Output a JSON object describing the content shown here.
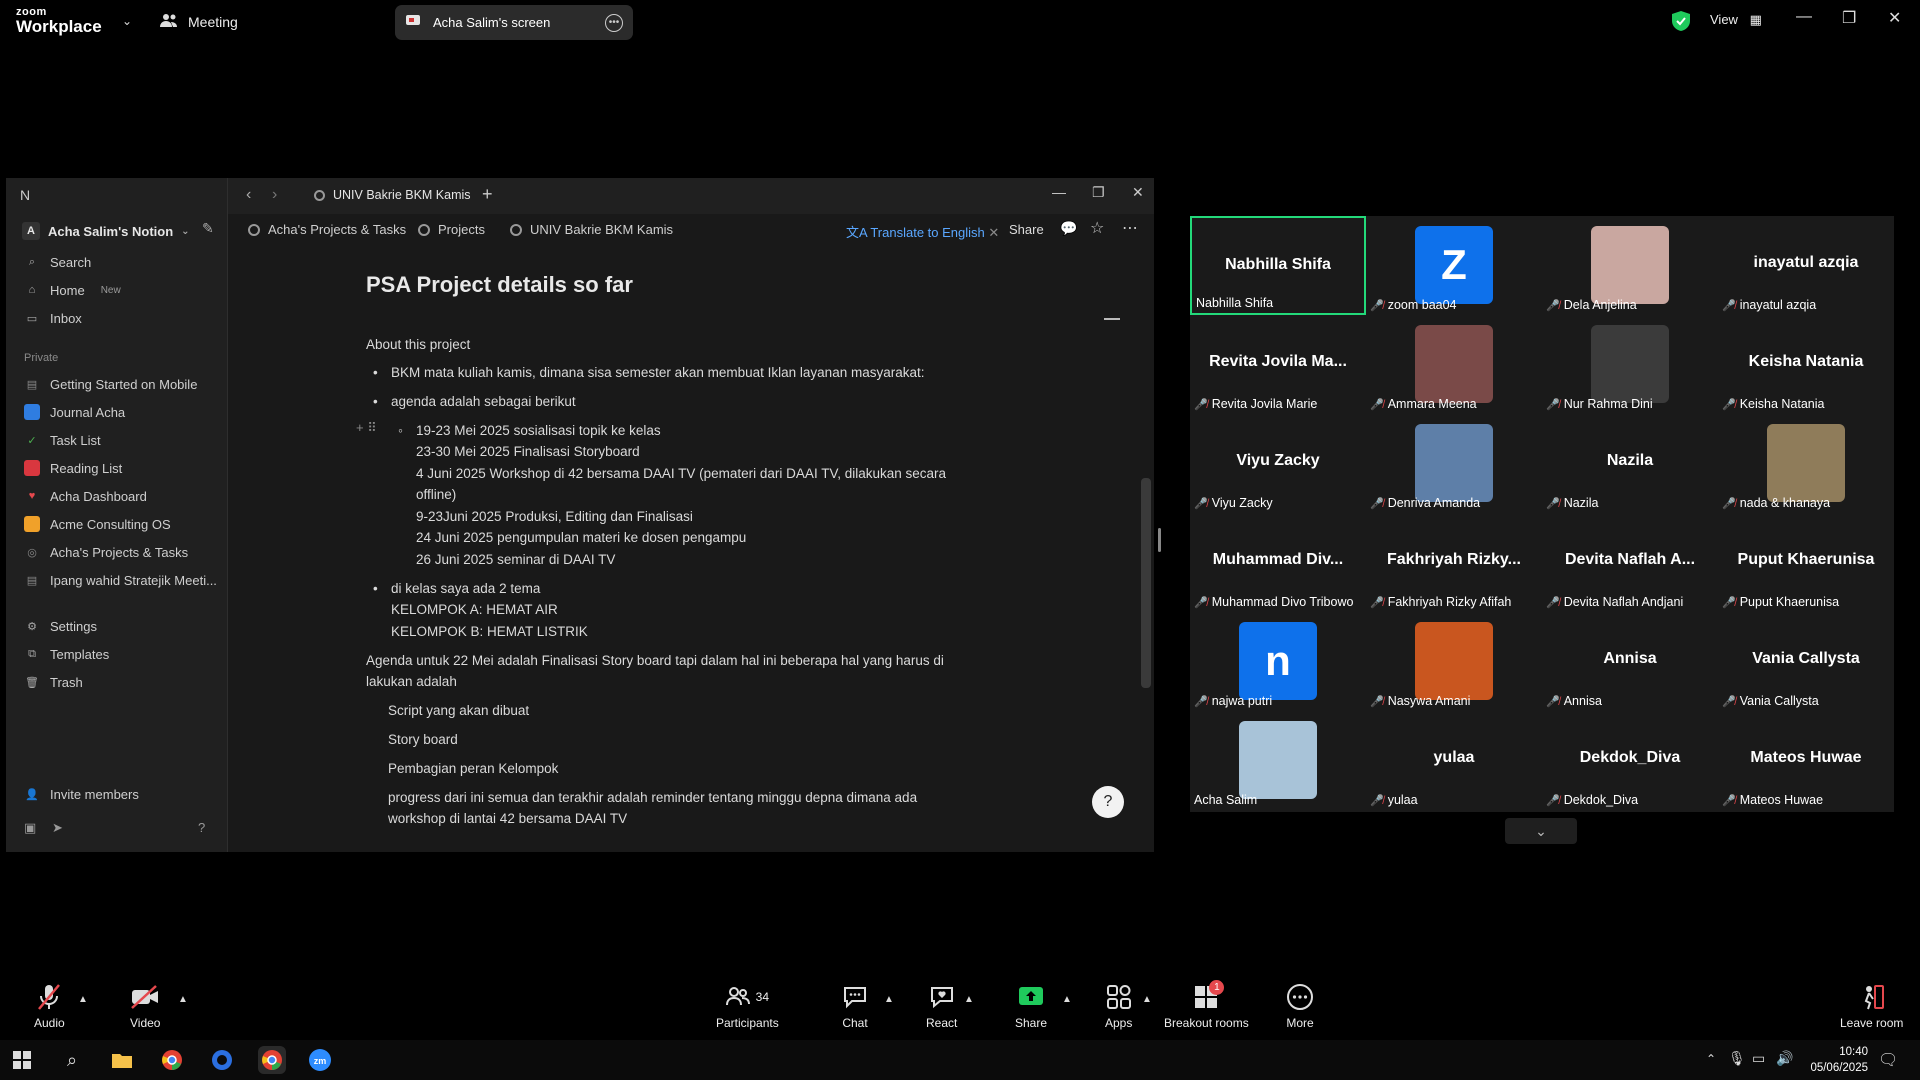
{
  "topbar": {
    "logo_small": "zoom",
    "logo_big": "Workplace",
    "meeting_label": "Meeting",
    "share_pill": "Acha Salim's screen",
    "view_label": "View"
  },
  "notion": {
    "workspace": "Acha Salim's Notion",
    "tab_title": "UNIV Bakrie BKM Kamis",
    "search": "Search",
    "home": "Home",
    "home_badge": "New",
    "inbox": "Inbox",
    "private_label": "Private",
    "pages": [
      "Getting Started on Mobile",
      "Journal Acha",
      "Task List",
      "Reading List",
      "Acha Dashboard",
      "Acme Consulting OS",
      "Acha's Projects & Tasks",
      "Ipang wahid Stratejik Meeti..."
    ],
    "settings": "Settings",
    "templates": "Templates",
    "trash": "Trash",
    "invite": "Invite members",
    "breadcrumbs": [
      "Acha's Projects & Tasks",
      "Projects",
      "UNIV Bakrie BKM Kamis"
    ],
    "translate": "Translate to English",
    "share": "Share",
    "doc": {
      "title": "PSA Project details so far",
      "about": "About this project",
      "b1": "BKM mata kuliah kamis, dimana sisa semester akan membuat Iklan layanan masyarakat:",
      "b2": "agenda adalah sebagai berikut",
      "s1": "19-23 Mei 2025 sosialisasi topik ke kelas",
      "s2": "23-30 Mei 2025 Finalisasi Storyboard",
      "s3": "4 Juni 2025 Workshop di 42 bersama DAAI TV (pemateri dari DAAI TV, dilakukan secara",
      "s3b": "offline)",
      "s4": "9-23Juni 2025 Produksi, Editing dan Finalisasi",
      "s5": "24 Juni 2025 pengumpulan materi ke dosen pengampu",
      "s6": "26 Juni 2025 seminar di DAAI TV",
      "b3": "di kelas saya ada 2 tema",
      "b3a": "KELOMPOK A: HEMAT AIR",
      "b3b": "KELOMPOK B: HEMAT LISTRIK",
      "p1": "Agenda untuk 22 Mei adalah Finalisasi Story board tapi dalam hal ini beberapa hal yang harus di",
      "p1b": "lakukan adalah",
      "t1": "Script yang akan dibuat",
      "t2": "Story board",
      "t3": "Pembagian peran Kelompok",
      "t4": "progress dari ini semua dan terakhir adalah reminder tentang minggu depna dimana ada",
      "t4b": "workshop di lantai 42 bersama DAAI TV"
    }
  },
  "gallery": [
    {
      "big": "Nabhilla Shifa",
      "label": "Nabhilla Shifa",
      "muted": false,
      "active": true
    },
    {
      "letter": "Z",
      "label": "zoom baa04",
      "muted": true
    },
    {
      "photo": "#c9a7a0",
      "label": "Dela Anjelina",
      "muted": true
    },
    {
      "big": "inayatul azqia",
      "label": "inayatul azqia",
      "muted": true
    },
    {
      "big": "Revita Jovila Ma...",
      "label": "Revita Jovila Marie",
      "muted": true
    },
    {
      "photo": "#7a4a48",
      "label": "Ammara Meena",
      "muted": true
    },
    {
      "photo": "#3b3b3b",
      "label": "Nur Rahma Dini",
      "muted": true
    },
    {
      "big": "Keisha Natania",
      "label": "Keisha Natania",
      "muted": true
    },
    {
      "big": "Viyu Zacky",
      "label": "Viyu Zacky",
      "muted": true
    },
    {
      "photo": "#5e7fa8",
      "label": "Denriva Amanda",
      "muted": true
    },
    {
      "big": "Nazila",
      "label": "Nazila",
      "muted": true
    },
    {
      "photo": "#8f7c5a",
      "label": "nada & khanaya",
      "muted": true
    },
    {
      "big": "Muhammad Div...",
      "label": "Muhammad Divo Tribowo",
      "muted": true
    },
    {
      "big": "Fakhriyah Rizky...",
      "label": "Fakhriyah Rizky Afifah",
      "muted": true
    },
    {
      "big": "Devita Naflah A...",
      "label": "Devita Naflah Andjani",
      "muted": true
    },
    {
      "big": "Puput Khaerunisa",
      "label": "Puput Khaerunisa",
      "muted": true
    },
    {
      "letter": "n",
      "label": "najwa putri",
      "muted": true
    },
    {
      "photo": "#c9561f",
      "label": "Nasywa Amani",
      "muted": true
    },
    {
      "big": "Annisa",
      "label": "Annisa",
      "muted": true
    },
    {
      "big": "Vania Callysta",
      "label": "Vania Callysta",
      "muted": true
    },
    {
      "photo": "#a8c3d8",
      "label": "Acha Salim",
      "muted": false
    },
    {
      "big": "yulaa",
      "label": "yulaa",
      "muted": true
    },
    {
      "big": "Dekdok_Diva",
      "label": "Dekdok_Diva",
      "muted": true
    },
    {
      "big": "Mateos Huwae",
      "label": "Mateos Huwae",
      "muted": true
    }
  ],
  "toolbar": {
    "audio": "Audio",
    "video": "Video",
    "participants": "Participants",
    "participants_count": "34",
    "chat": "Chat",
    "react": "React",
    "share": "Share",
    "apps": "Apps",
    "breakout": "Breakout rooms",
    "breakout_badge": "1",
    "more": "More",
    "leave": "Leave room"
  },
  "taskbar": {
    "time": "10:40",
    "date": "05/06/2025"
  },
  "colors": {
    "active_speaker": "#23d97a",
    "muted": "#e5484d",
    "share_green": "#1fca5c",
    "link_blue": "#5aa7ff"
  }
}
